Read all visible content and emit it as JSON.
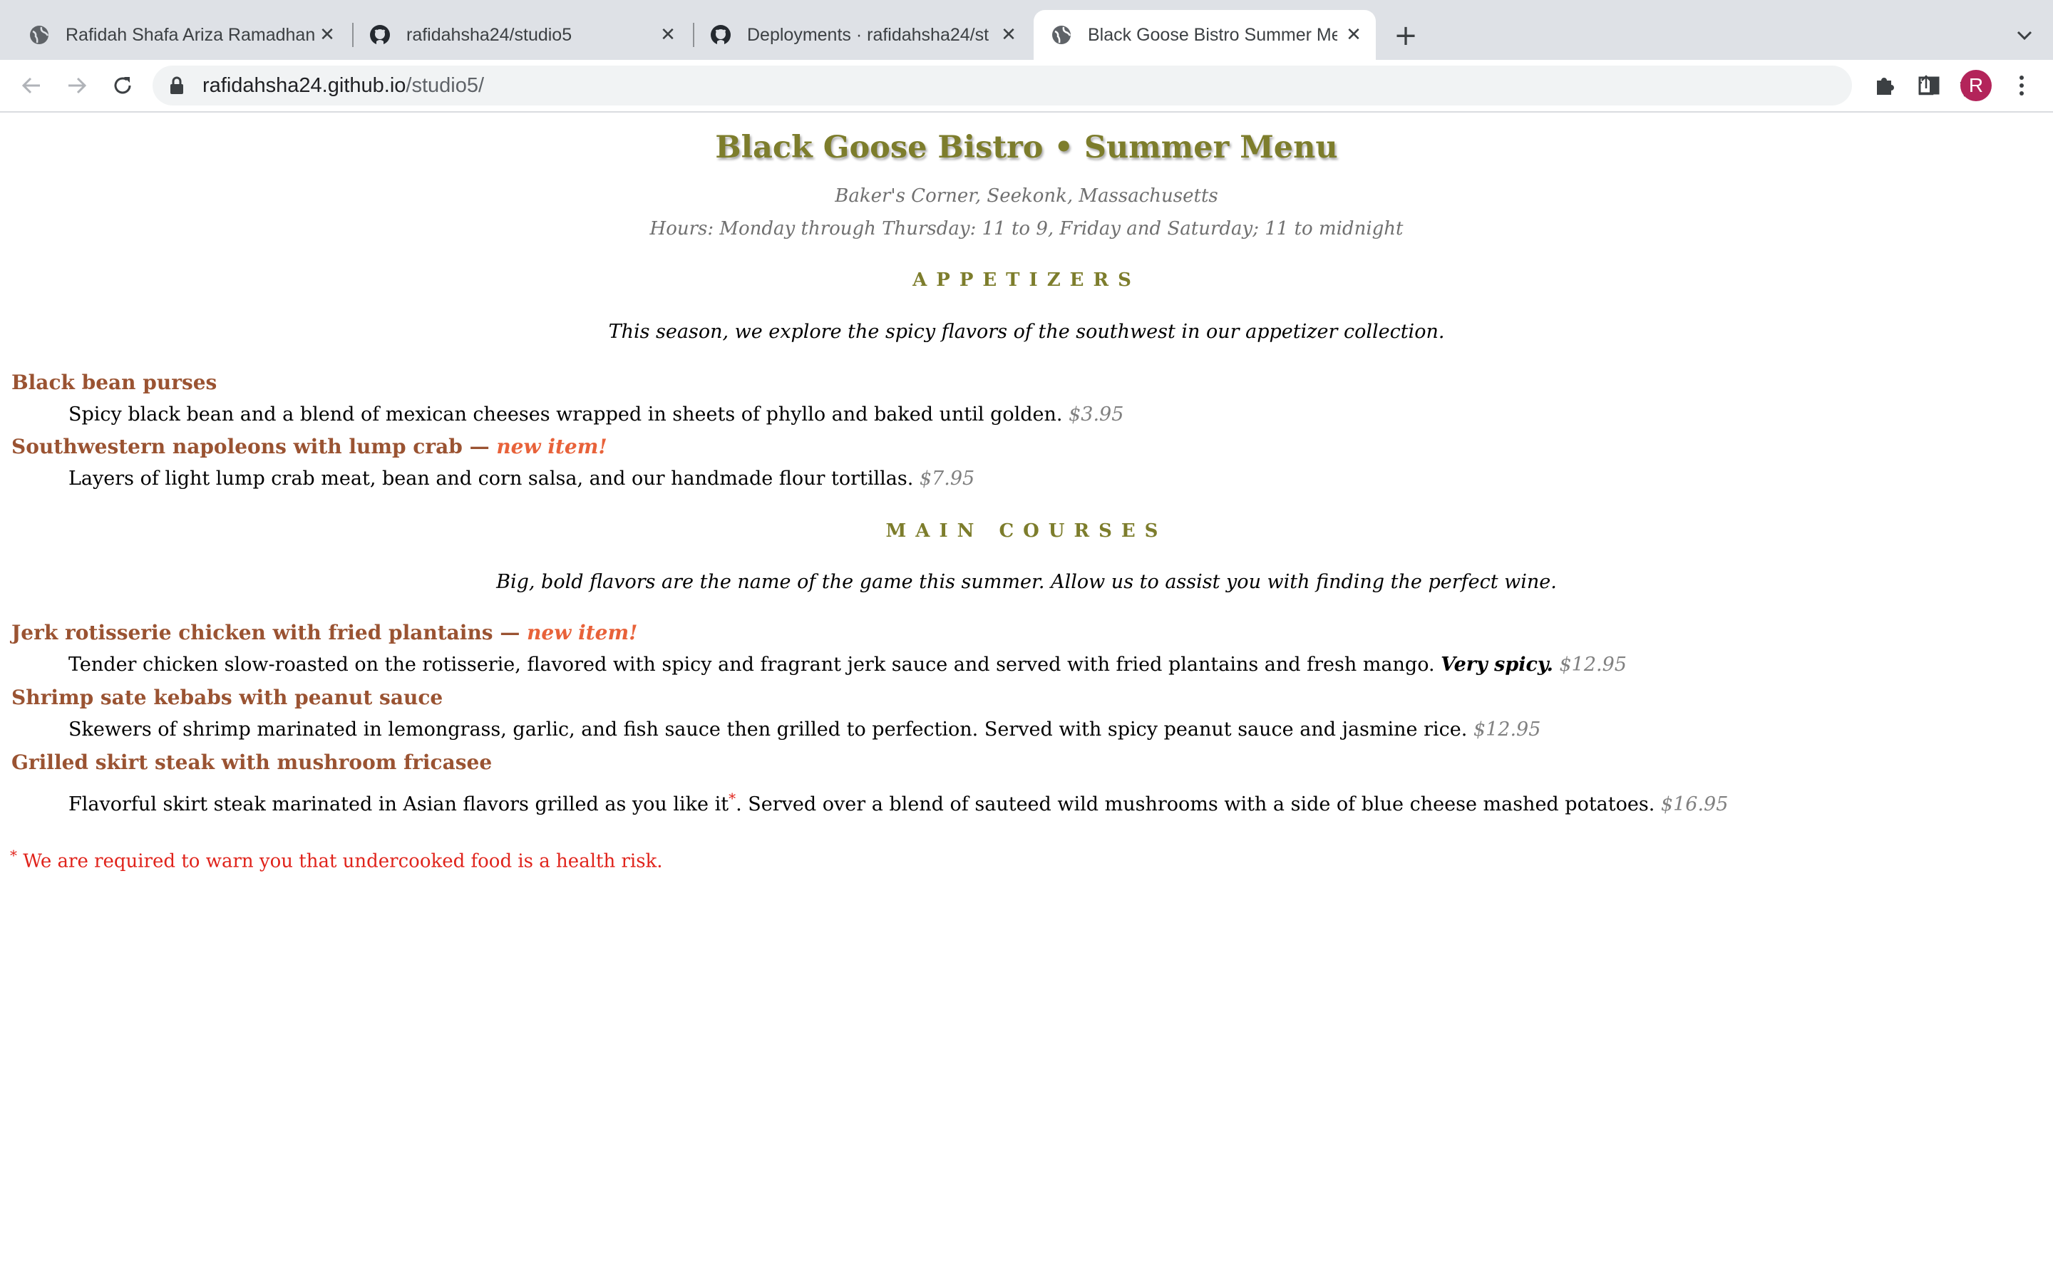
{
  "browser": {
    "tabs": [
      {
        "title": "Rafidah Shafa Ariza Ramadhan",
        "icon": "globe-icon",
        "active": false
      },
      {
        "title": "rafidahsha24/studio5",
        "icon": "github-icon",
        "active": false
      },
      {
        "title": "Deployments · rafidahsha24/st",
        "icon": "github-icon",
        "active": false
      },
      {
        "title": "Black Goose Bistro Summer Me",
        "icon": "globe-icon",
        "active": true
      }
    ],
    "url_host": "rafidahsha24.github.io",
    "url_path": "/studio5/",
    "profile_initial": "R",
    "profile_color": "#b3245a"
  },
  "menu": {
    "title": "Black Goose Bistro • Summer Menu",
    "location": "Baker's Corner, Seekonk, Massachusetts",
    "hours": "Hours: Monday through Thursday: 11 to 9, Friday and Saturday; 11 to midnight",
    "appetizers": {
      "heading": "APPETIZERS",
      "intro": "This season, we explore the spicy flavors of the southwest in our appetizer collection.",
      "items": [
        {
          "name": "Black bean purses",
          "new": "",
          "desc": "Spicy black bean and a blend of mexican cheeses wrapped in sheets of phyllo and baked until golden.",
          "price": "$3.95"
        },
        {
          "name": "Southwestern napoleons with lump crab — ",
          "new": "new item!",
          "desc": "Layers of light lump crab meat, bean and corn salsa, and our handmade flour tortillas.",
          "price": "$7.95"
        }
      ]
    },
    "main_courses": {
      "heading": "MAIN COURSES",
      "intro": "Big, bold flavors are the name of the game this summer. Allow us to assist you with finding the perfect wine.",
      "items": [
        {
          "name": "Jerk rotisserie chicken with fried plantains — ",
          "new": "new item!",
          "desc": "Tender chicken slow-roasted on the rotisserie, flavored with spicy and fragrant jerk sauce and served with fried plantains and fresh mango.",
          "extra": "Very spicy.",
          "price": "$12.95"
        },
        {
          "name": "Shrimp sate kebabs with peanut sauce",
          "new": "",
          "desc": "Skewers of shrimp marinated in lemongrass, garlic, and fish sauce then grilled to perfection. Served with spicy peanut sauce and jasmine rice.",
          "price": "$12.95"
        },
        {
          "name": "Grilled skirt steak with mushroom fricasee",
          "new": "",
          "desc_a": "Flavorful skirt steak marinated in Asian flavors grilled as you like it",
          "mark": "*",
          "desc_b": ". Served over a blend of sauteed wild mushrooms with a side of blue cheese mashed potatoes.",
          "price": "$16.95"
        }
      ]
    },
    "footnote": {
      "mark": "*",
      "text": " We are required to warn you that undercooked food is a health risk."
    },
    "colors": {
      "heading": "#7d7d2c",
      "dish": "#9a5332",
      "new_item": "#e8623a",
      "warning": "#e0231b"
    }
  }
}
